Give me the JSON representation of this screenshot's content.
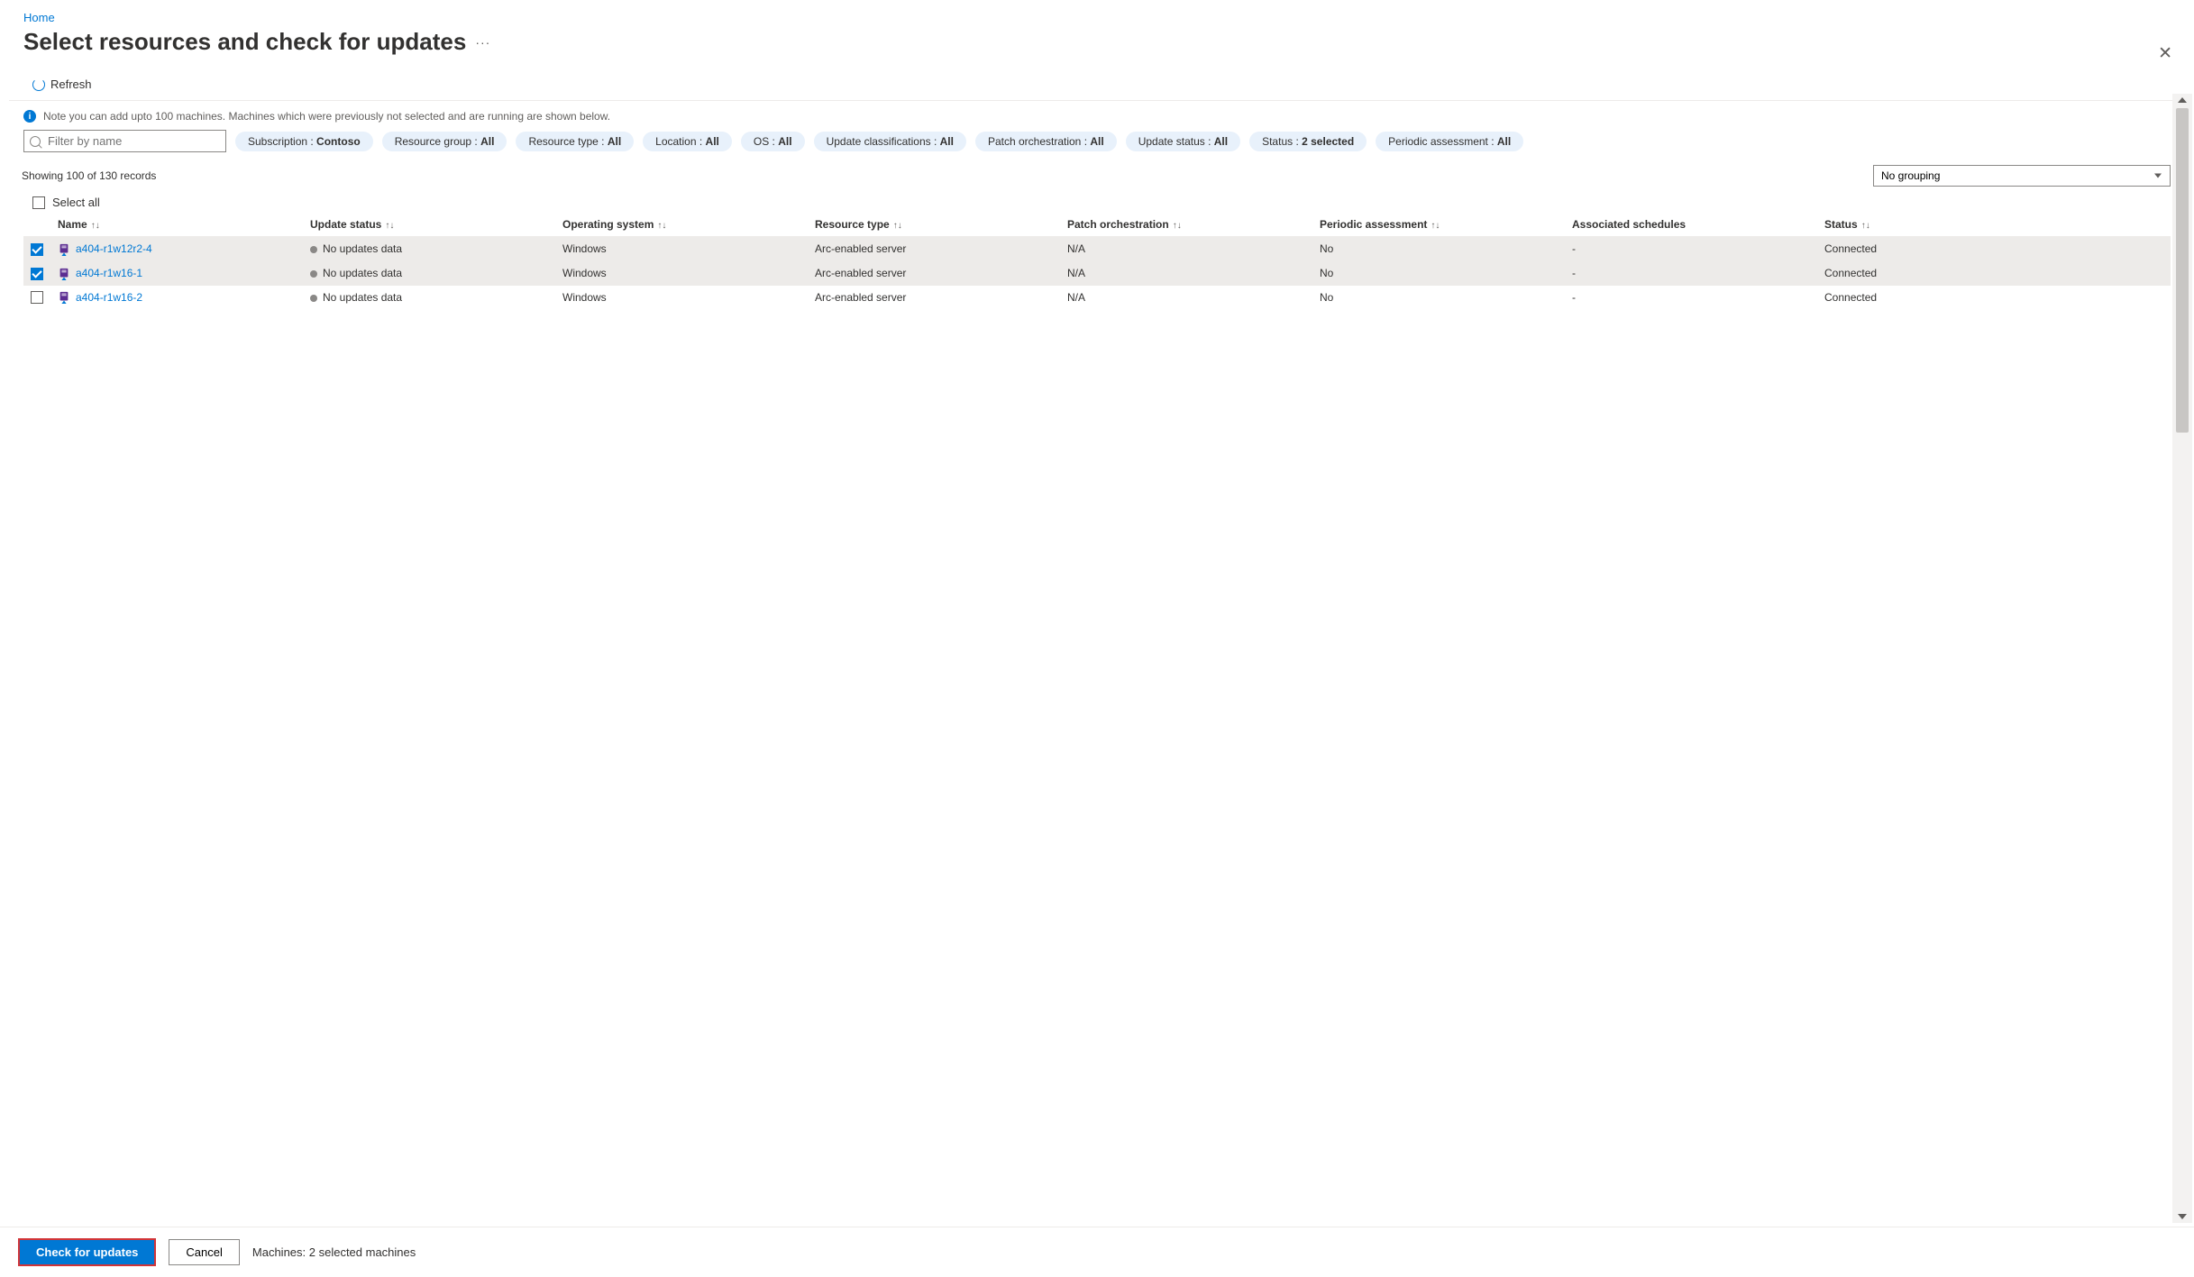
{
  "breadcrumb": {
    "home": "Home"
  },
  "page": {
    "title": "Select resources and check for updates",
    "more": "···"
  },
  "toolbar": {
    "refresh": "Refresh"
  },
  "note": {
    "text": "Note you can add upto 100 machines. Machines which were previously not selected and are running are shown below."
  },
  "filter": {
    "placeholder": "Filter by name"
  },
  "pills": {
    "subscription_label": "Subscription : ",
    "subscription_value": "Contoso",
    "resource_group_label": "Resource group : ",
    "resource_group_value": "All",
    "resource_type_label": "Resource type : ",
    "resource_type_value": "All",
    "location_label": "Location : ",
    "location_value": "All",
    "os_label": "OS : ",
    "os_value": "All",
    "update_class_label": "Update classifications : ",
    "update_class_value": "All",
    "patch_orch_label": "Patch orchestration : ",
    "patch_orch_value": "All",
    "update_status_label": "Update status : ",
    "update_status_value": "All",
    "status_label": "Status : ",
    "status_value": "2 selected",
    "periodic_label": "Periodic assessment : ",
    "periodic_value": "All"
  },
  "records": {
    "count": "Showing 100 of 130 records"
  },
  "grouping": {
    "value": "No grouping"
  },
  "selectAll": {
    "label": "Select all"
  },
  "columns": {
    "name": "Name",
    "update_status": "Update status",
    "os": "Operating system",
    "resource_type": "Resource type",
    "patch": "Patch orchestration",
    "periodic": "Periodic assessment",
    "schedules": "Associated schedules",
    "status": "Status"
  },
  "rows": [
    {
      "selected": true,
      "name": "a404-r1w12r2-4",
      "update_status": "No updates data",
      "os": "Windows",
      "resource_type": "Arc-enabled server",
      "patch": "N/A",
      "periodic": "No",
      "schedules": "-",
      "status": "Connected"
    },
    {
      "selected": true,
      "name": "a404-r1w16-1",
      "update_status": "No updates data",
      "os": "Windows",
      "resource_type": "Arc-enabled server",
      "patch": "N/A",
      "periodic": "No",
      "schedules": "-",
      "status": "Connected"
    },
    {
      "selected": false,
      "name": "a404-r1w16-2",
      "update_status": "No updates data",
      "os": "Windows",
      "resource_type": "Arc-enabled server",
      "patch": "N/A",
      "periodic": "No",
      "schedules": "-",
      "status": "Connected"
    }
  ],
  "footer": {
    "check": "Check for updates",
    "cancel": "Cancel",
    "status": "Machines: 2 selected machines"
  }
}
